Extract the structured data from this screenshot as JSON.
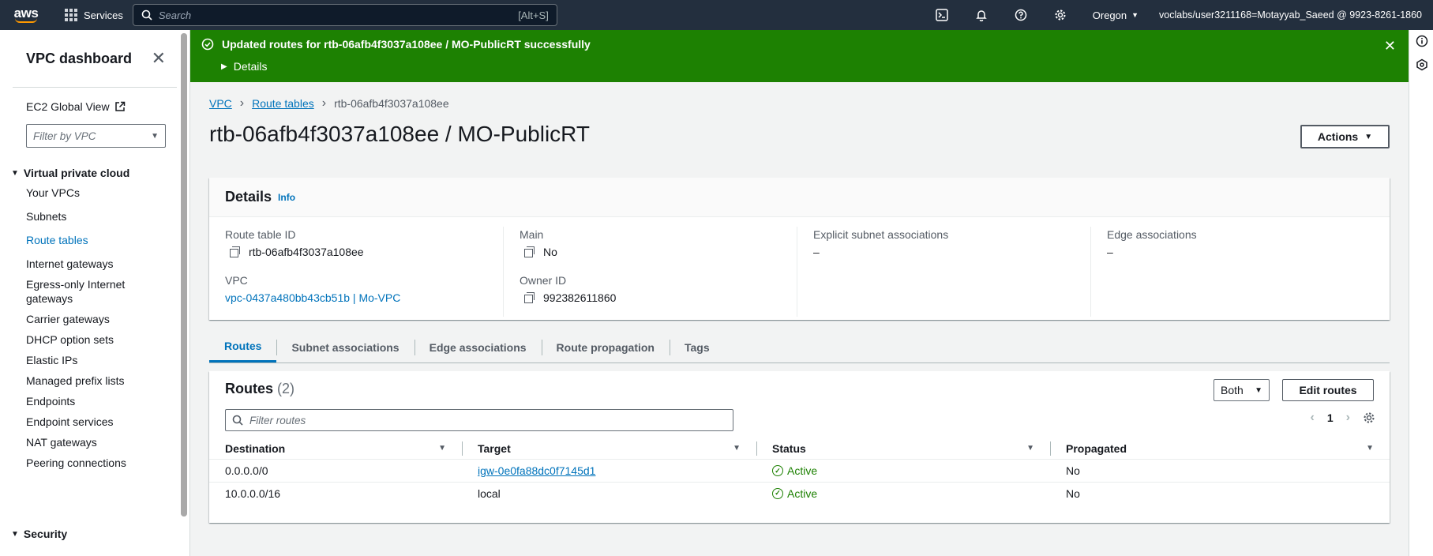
{
  "topnav": {
    "logo": "aws",
    "services_label": "Services",
    "search_placeholder": "Search",
    "search_shortcut": "[Alt+S]",
    "icons": [
      "cloudshell-icon",
      "bell-icon",
      "help-icon",
      "gear-icon"
    ],
    "region": "Oregon",
    "account": "voclabs/user3211168=Motayyab_Saeed @ 9923-8261-1860"
  },
  "sidebar": {
    "title": "VPC dashboard",
    "ec2_link": "EC2 Global View",
    "filter_placeholder": "Filter by VPC",
    "section1": "Virtual private cloud",
    "items": [
      {
        "label": "Your VPCs"
      },
      {
        "label": "Subnets"
      },
      {
        "label": "Route tables"
      },
      {
        "label": "Internet gateways"
      },
      {
        "label": "Egress-only Internet gateways"
      },
      {
        "label": "Carrier gateways"
      },
      {
        "label": "DHCP option sets"
      },
      {
        "label": "Elastic IPs"
      },
      {
        "label": "Managed prefix lists"
      },
      {
        "label": "Endpoints"
      },
      {
        "label": "Endpoint services"
      },
      {
        "label": "NAT gateways"
      },
      {
        "label": "Peering connections"
      }
    ],
    "active_item": "Route tables",
    "section2": "Security"
  },
  "flash": {
    "message": "Updated routes for rtb-06afb4f3037a108ee / MO-PublicRT successfully",
    "details_label": "Details",
    "color": "#1d8102"
  },
  "breadcrumb": {
    "items": [
      "VPC",
      "Route tables"
    ],
    "current": "rtb-06afb4f3037a108ee"
  },
  "page": {
    "title": "rtb-06afb4f3037a108ee / MO-PublicRT",
    "actions_label": "Actions"
  },
  "details": {
    "heading": "Details",
    "info": "Info",
    "route_table_id_label": "Route table ID",
    "route_table_id": "rtb-06afb4f3037a108ee",
    "vpc_label": "VPC",
    "vpc": "vpc-0437a480bb43cb51b | Mo-VPC",
    "main_label": "Main",
    "main": "No",
    "owner_label": "Owner ID",
    "owner": "992382611860",
    "explicit_label": "Explicit subnet associations",
    "explicit": "–",
    "edge_label": "Edge associations",
    "edge": "–"
  },
  "tabs": [
    "Routes",
    "Subnet associations",
    "Edge associations",
    "Route propagation",
    "Tags"
  ],
  "routes": {
    "heading": "Routes",
    "count": "(2)",
    "filter_select": "Both",
    "edit_label": "Edit routes",
    "filter_placeholder": "Filter routes",
    "page": "1",
    "columns": [
      "Destination",
      "Target",
      "Status",
      "Propagated"
    ],
    "rows": [
      {
        "destination": "0.0.0.0/0",
        "target": "igw-0e0fa88dc0f7145d1",
        "status": "Active",
        "propagated": "No"
      },
      {
        "destination": "10.0.0.0/16",
        "target": "local",
        "status": "Active",
        "propagated": "No"
      }
    ]
  }
}
